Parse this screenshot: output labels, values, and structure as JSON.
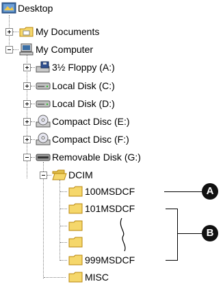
{
  "tree": {
    "root": {
      "label": "Desktop",
      "icon": "desktop-icon"
    },
    "items": [
      {
        "label": "My Documents",
        "icon": "my-documents-folder-icon"
      },
      {
        "label": "My Computer",
        "icon": "my-computer-icon"
      },
      {
        "label": "3½ Floppy (A:)",
        "icon": "floppy-drive-icon"
      },
      {
        "label": "Local Disk (C:)",
        "icon": "hard-disk-icon"
      },
      {
        "label": "Local Disk (D:)",
        "icon": "hard-disk-icon"
      },
      {
        "label": "Compact Disc (E:)",
        "icon": "cd-drive-icon"
      },
      {
        "label": "Compact Disc (F:)",
        "icon": "cd-drive-icon"
      },
      {
        "label": "Removable Disk (G:)",
        "icon": "removable-disk-icon"
      },
      {
        "label": "DCIM",
        "icon": "open-folder-icon"
      },
      {
        "label": "100MSDCF",
        "icon": "folder-icon"
      },
      {
        "label": "101MSDCF",
        "icon": "folder-icon"
      },
      {
        "label": "",
        "icon": "folder-icon"
      },
      {
        "label": "",
        "icon": "folder-icon"
      },
      {
        "label": "999MSDCF",
        "icon": "folder-icon"
      },
      {
        "label": "MISC",
        "icon": "folder-icon"
      }
    ]
  },
  "callouts": {
    "a": "A",
    "b": "B"
  },
  "colors": {
    "folder": "#f5d76b",
    "folder_edge": "#b8860b",
    "callout": "#111111"
  }
}
